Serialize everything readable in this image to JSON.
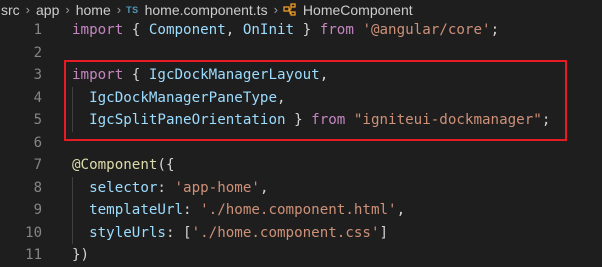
{
  "breadcrumb": {
    "segments": [
      "src",
      "app",
      "home"
    ],
    "file_badge": "TS",
    "file_name": "home.component.ts",
    "symbol_name": "HomeComponent"
  },
  "code_lines": [
    {
      "number": "1",
      "tokens": [
        {
          "t": "import",
          "c": "kw"
        },
        {
          "t": " { ",
          "c": "pn"
        },
        {
          "t": "Component",
          "c": "id"
        },
        {
          "t": ", ",
          "c": "pn"
        },
        {
          "t": "OnInit",
          "c": "id"
        },
        {
          "t": " } ",
          "c": "pn"
        },
        {
          "t": "from",
          "c": "kw"
        },
        {
          "t": " ",
          "c": "pn"
        },
        {
          "t": "'@angular/core'",
          "c": "str"
        },
        {
          "t": ";",
          "c": "pn"
        }
      ]
    },
    {
      "number": "2",
      "tokens": []
    },
    {
      "number": "3",
      "tokens": [
        {
          "t": "import",
          "c": "kw"
        },
        {
          "t": " { ",
          "c": "pn"
        },
        {
          "t": "IgcDockManagerLayout",
          "c": "id"
        },
        {
          "t": ",",
          "c": "pn"
        }
      ]
    },
    {
      "number": "4",
      "guide": true,
      "tokens": [
        {
          "t": "  IgcDockManagerPaneType",
          "c": "id"
        },
        {
          "t": ",",
          "c": "pn"
        }
      ]
    },
    {
      "number": "5",
      "guide": true,
      "tokens": [
        {
          "t": "  IgcSplitPaneOrientation",
          "c": "id"
        },
        {
          "t": " } ",
          "c": "pn"
        },
        {
          "t": "from",
          "c": "kw"
        },
        {
          "t": " ",
          "c": "pn"
        },
        {
          "t": "\"igniteui-dockmanager\"",
          "c": "str"
        },
        {
          "t": ";",
          "c": "pn"
        }
      ]
    },
    {
      "number": "6",
      "tokens": []
    },
    {
      "number": "7",
      "tokens": [
        {
          "t": "@",
          "c": "dec"
        },
        {
          "t": "Component",
          "c": "dec"
        },
        {
          "t": "({",
          "c": "pn"
        }
      ]
    },
    {
      "number": "8",
      "guide": true,
      "tokens": [
        {
          "t": "  selector",
          "c": "id"
        },
        {
          "t": ": ",
          "c": "pn"
        },
        {
          "t": "'app-home'",
          "c": "str"
        },
        {
          "t": ",",
          "c": "pn"
        }
      ]
    },
    {
      "number": "9",
      "guide": true,
      "tokens": [
        {
          "t": "  templateUrl",
          "c": "id"
        },
        {
          "t": ": ",
          "c": "pn"
        },
        {
          "t": "'./home.component.html'",
          "c": "str"
        },
        {
          "t": ",",
          "c": "pn"
        }
      ]
    },
    {
      "number": "10",
      "guide": true,
      "tokens": [
        {
          "t": "  styleUrls",
          "c": "id"
        },
        {
          "t": ": [",
          "c": "pn"
        },
        {
          "t": "'./home.component.css'",
          "c": "str"
        },
        {
          "t": "]",
          "c": "pn"
        }
      ]
    },
    {
      "number": "11",
      "tokens": [
        {
          "t": "})",
          "c": "pn"
        }
      ]
    }
  ],
  "colors": {
    "highlight_border": "#e61b23",
    "background": "#1e1e1e"
  }
}
